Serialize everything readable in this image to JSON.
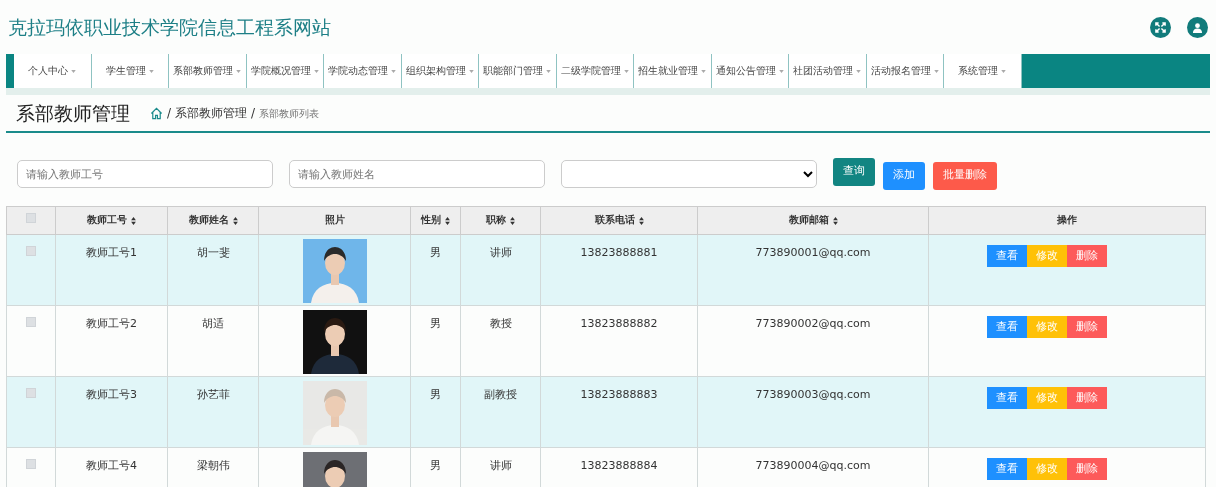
{
  "site_title": "克拉玛依职业技术学院信息工程系网站",
  "nav": [
    {
      "label": "个人中心"
    },
    {
      "label": "学生管理"
    },
    {
      "label": "系部教师管理"
    },
    {
      "label": "学院概况管理"
    },
    {
      "label": "学院动态管理"
    },
    {
      "label": "组织架构管理"
    },
    {
      "label": "职能部门管理"
    },
    {
      "label": "二级学院管理"
    },
    {
      "label": "招生就业管理"
    },
    {
      "label": "通知公告管理"
    },
    {
      "label": "社团活动管理"
    },
    {
      "label": "活动报名管理"
    },
    {
      "label": "系统管理"
    }
  ],
  "page_title": "系部教师管理",
  "breadcrumb": {
    "separator": "/",
    "items": [
      "系部教师管理",
      "系部教师列表"
    ]
  },
  "filters": [
    {
      "placeholder": "请输入教师工号"
    },
    {
      "placeholder": "请输入教师姓名"
    }
  ],
  "buttons": [
    {
      "label": "查询",
      "kind": "search"
    },
    {
      "label": "添加",
      "kind": "add"
    },
    {
      "label": "批量删除",
      "kind": "delete"
    }
  ],
  "table": {
    "header_checked": false,
    "columns": [
      {
        "label": "教师工号",
        "sortable": true
      },
      {
        "label": "教师姓名",
        "sortable": true
      },
      {
        "label": "照片",
        "sortable": false
      },
      {
        "label": "性别",
        "sortable": true
      },
      {
        "label": "职称",
        "sortable": true
      },
      {
        "label": "联系电话",
        "sortable": true
      },
      {
        "label": "教师邮箱",
        "sortable": true
      },
      {
        "label": "操作",
        "sortable": false
      }
    ],
    "rows": [
      {
        "checked": false,
        "cells": [
          "教师工号1",
          "胡一斐",
          {
            "kind": "picture"
          },
          "男",
          "讲师",
          "13823888881",
          "773890001@qq.com"
        ],
        "actions": [
          "查看",
          "修改",
          "删除"
        ]
      },
      {
        "checked": false,
        "cells": [
          "教师工号2",
          "胡适",
          {
            "kind": "picture"
          },
          "男",
          "教授",
          "13823888882",
          "773890002@qq.com"
        ],
        "actions": [
          "查看",
          "修改",
          "删除"
        ]
      },
      {
        "checked": false,
        "cells": [
          "教师工号3",
          "孙艺菲",
          {
            "kind": "picture"
          },
          "男",
          "副教授",
          "13823888883",
          "773890003@qq.com"
        ],
        "actions": [
          "查看",
          "修改",
          "删除"
        ]
      },
      {
        "checked": false,
        "cells": [
          "教师工号4",
          "梁朝伟",
          {
            "kind": "picture"
          },
          "男",
          "讲师",
          "13823888884",
          "773890004@qq.com"
        ],
        "actions": [
          "查看",
          "修改",
          "删除"
        ]
      }
    ]
  }
}
